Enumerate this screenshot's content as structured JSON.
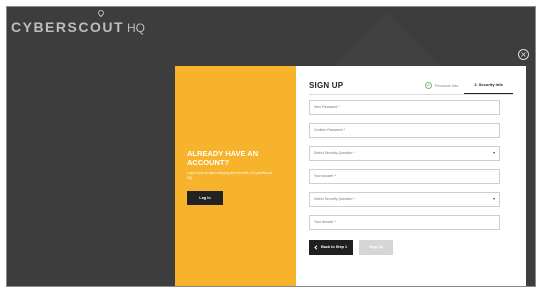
{
  "logo": {
    "part1": "CYBER",
    "part2": "SCOUT",
    "part3": "HQ"
  },
  "login_panel": {
    "heading": "ALREADY HAVE AN ACCOUNT?",
    "description": "Log in now to start enjoying the benefits of CyberScout HQ.",
    "button_label": "Log In"
  },
  "signup": {
    "title": "SIGN UP",
    "steps": [
      {
        "label": "Personal Info",
        "completed": true
      },
      {
        "label": "2. Security Info",
        "active": true
      }
    ],
    "fields": [
      {
        "placeholder": "New Password *",
        "type": "text"
      },
      {
        "placeholder": "Confirm Password *",
        "type": "text"
      },
      {
        "placeholder": "Select Security Question *",
        "type": "select"
      },
      {
        "placeholder": "Your Answer *",
        "type": "text"
      },
      {
        "placeholder": "Select Security Question *",
        "type": "select"
      },
      {
        "placeholder": "Your Answer *",
        "type": "text"
      }
    ],
    "back_label": "Back to Step 1",
    "submit_label": "Sign Up"
  },
  "colors": {
    "accent": "#f7b32b",
    "background": "#3d3d3d",
    "dark_button": "#1f1f1f",
    "disabled_button": "#d6d6d6"
  }
}
